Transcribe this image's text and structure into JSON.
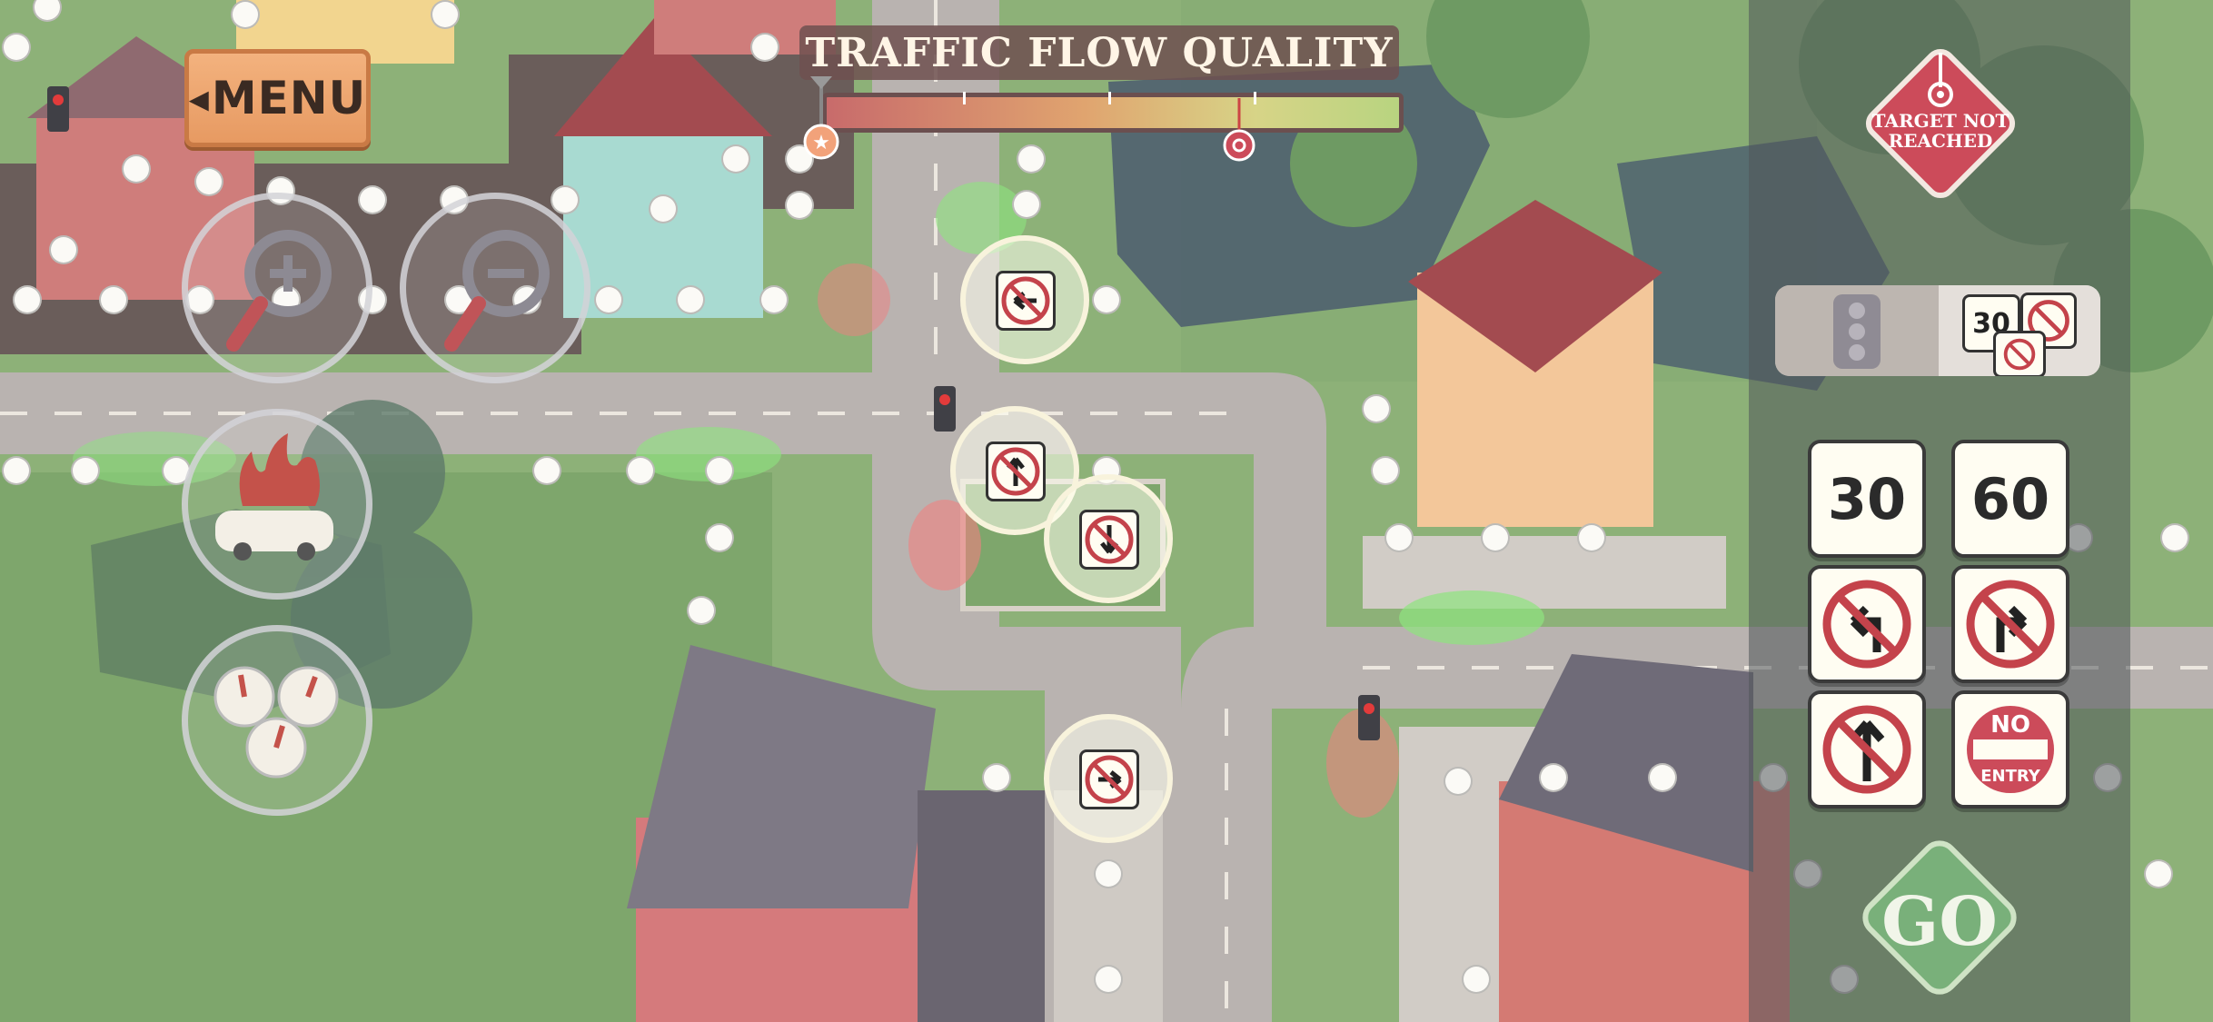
{
  "menu": {
    "label": "MENU"
  },
  "traffic_flow": {
    "title": "TRAFFIC FLOW QUALITY",
    "current_level": 0.72
  },
  "target": {
    "text_line1": "TARGET NOT",
    "text_line2": "REACHED"
  },
  "sign_palette": {
    "speed_30": "30",
    "speed_60": "60",
    "no_entry_top": "NO",
    "no_entry_bottom": "ENTRY",
    "toggle_preview_number": "30"
  },
  "go": {
    "label": "GO"
  },
  "colors": {
    "accent_red": "#cc4b5a",
    "go_green": "#79b07a",
    "menu_orange": "#e89b63"
  }
}
